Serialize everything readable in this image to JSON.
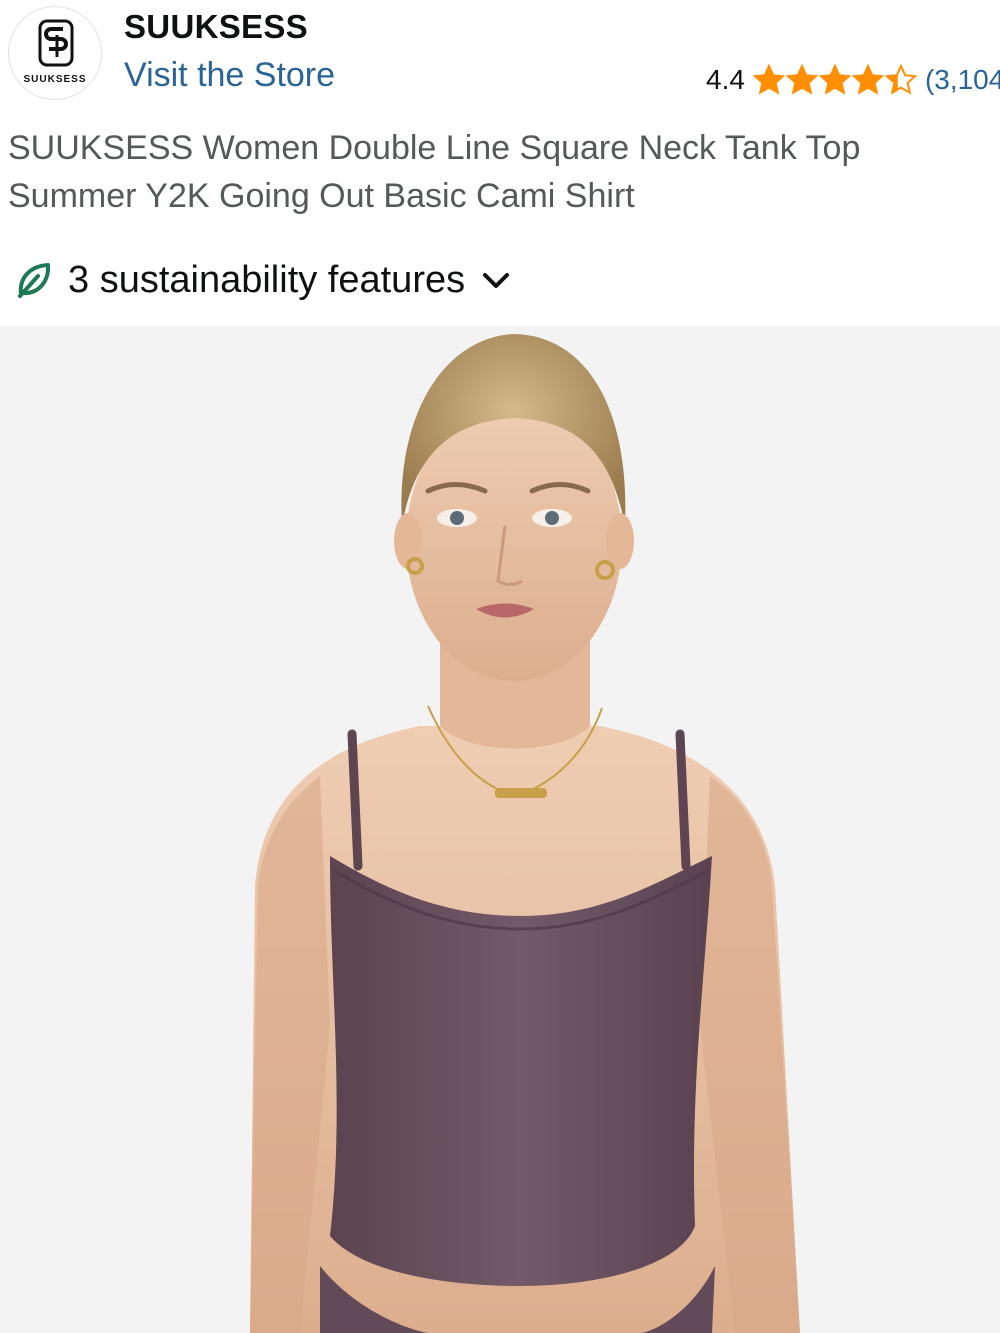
{
  "store": {
    "logo_text": "SUUKSESS",
    "brand_name": "SUUKSESS",
    "visit_link": "Visit the Store"
  },
  "rating": {
    "score": "4.4",
    "stars_value": 4.4,
    "stars_max": 5,
    "count": "(3,104"
  },
  "product": {
    "title": "SUUKSESS Women Double Line Square Neck Tank Top Summer Y2K Going Out Basic Cami Shirt"
  },
  "sustainability": {
    "label": "3 sustainability features",
    "icon": "leaf-icon",
    "toggle_icon": "chevron-down-icon"
  },
  "image": {
    "description_icon": "product-photo",
    "top_color": "#6e5462",
    "skin_color": "#e9c4a8",
    "hair_color": "#b89a66"
  },
  "colors": {
    "link": "#2a6496",
    "star": "#ff8f00",
    "leaf": "#1e7a55"
  }
}
